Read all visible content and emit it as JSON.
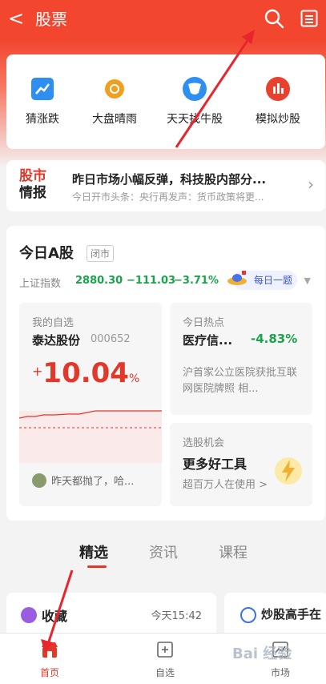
{
  "header": {
    "back": "<",
    "title": "股票"
  },
  "quick": [
    {
      "label": "猜涨跌",
      "icon": "trend-chart-icon",
      "color": "#2f8ff0"
    },
    {
      "label": "大盘晴雨",
      "icon": "sun-icon",
      "color": "#f0a020"
    },
    {
      "label": "天天找牛股",
      "icon": "bull-icon",
      "color": "#2f8ff0"
    },
    {
      "label": "模拟炒股",
      "icon": "bar-chart-icon",
      "color": "#e8422f"
    }
  ],
  "news": {
    "logo_top": "股市",
    "logo_bottom": "情报",
    "headline": "昨日市场小幅反弹，科技股内部分...",
    "sub": "今日开市头条：央行再发声：货币政策将更..."
  },
  "astock": {
    "title": "今日A股",
    "status": "闭市",
    "index_name": "上证指数",
    "index_value": "2880.30",
    "index_change": "−111.03",
    "index_pct": "−3.71%",
    "daily_label": "每日一题",
    "watch": {
      "label": "我的自选",
      "stock_name": "泰达股份",
      "stock_code": "000652",
      "plus": "+",
      "pct": "10.04",
      "unit": "%",
      "comment": "昨天都抛了，哈..."
    },
    "hot": {
      "label": "今日热点",
      "sector": "医疗信...",
      "change": "-4.83%",
      "desc": "沪首家公立医院获批互联网医院牌照 相..."
    },
    "chance": {
      "label": "选股机会",
      "title": "更多好工具",
      "desc": "超百万人在使用 >"
    }
  },
  "tabs": [
    "精选",
    "资讯",
    "课程"
  ],
  "feed": {
    "left_title": "收藏",
    "left_time": "今天15:42",
    "right_title": "炒股高手在"
  },
  "nav": [
    {
      "label": "首页",
      "icon": "store-icon",
      "active": true
    },
    {
      "label": "自选",
      "icon": "add-box-icon",
      "active": false
    },
    {
      "label": "市场",
      "icon": "chart-box-icon",
      "active": false
    }
  ],
  "watermark": "Bai 经验",
  "colors": {
    "brand": "#f2462f",
    "up": "#e2382a",
    "down": "#1aa34a"
  }
}
